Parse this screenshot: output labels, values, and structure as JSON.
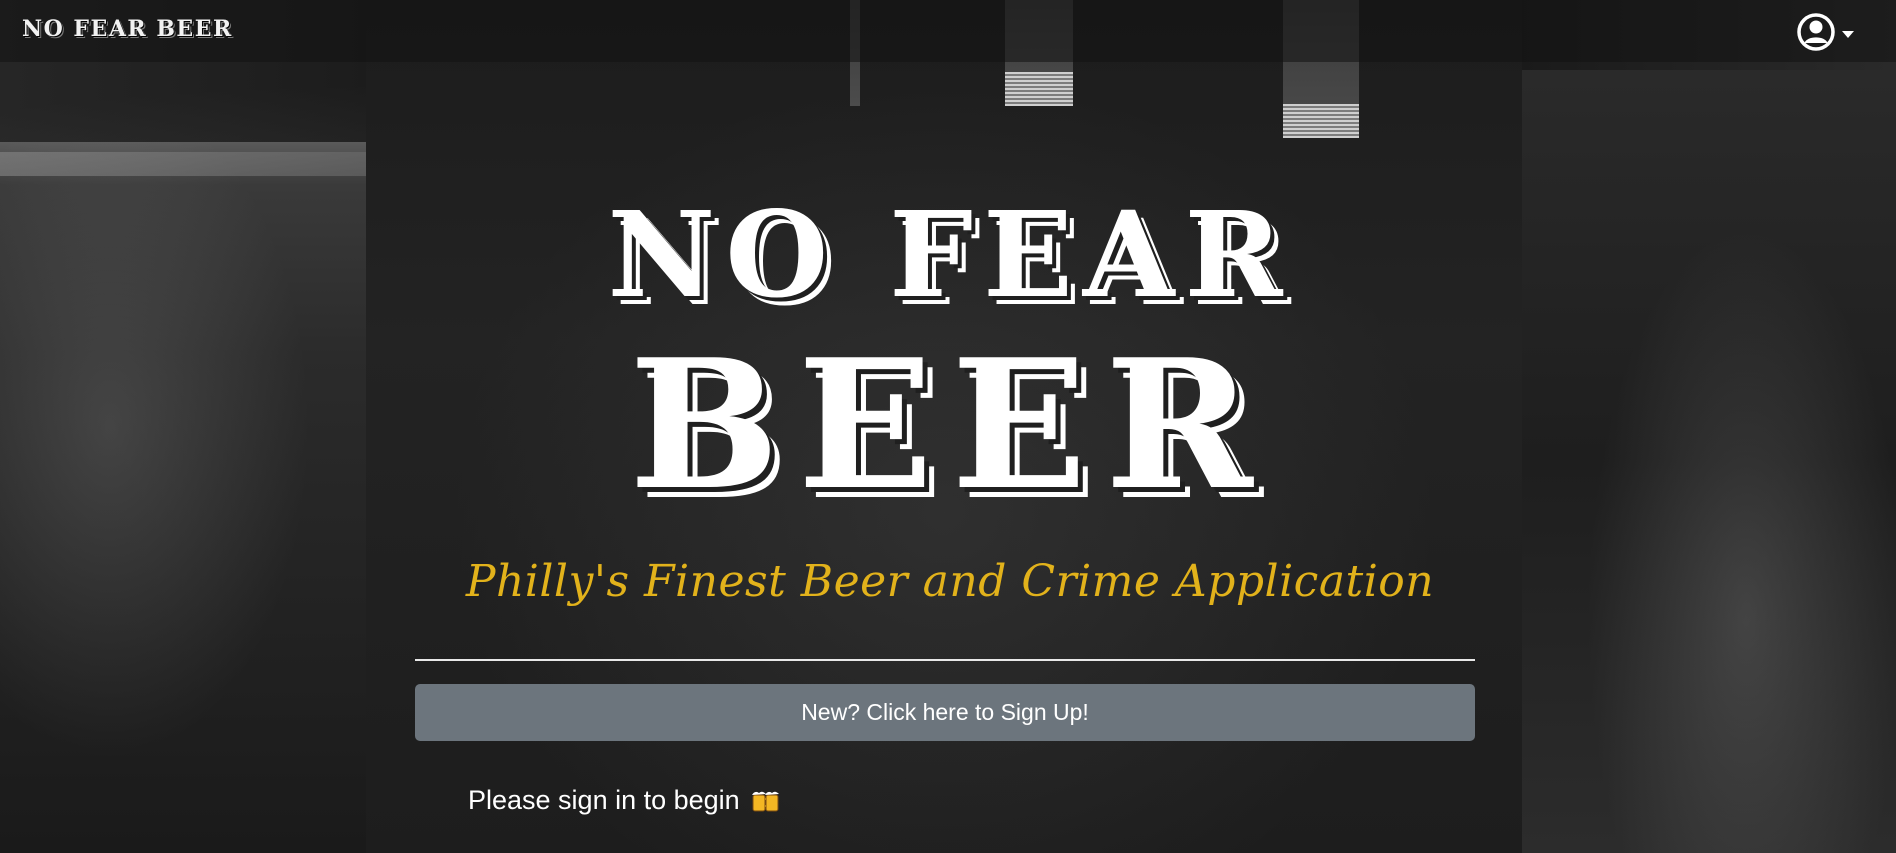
{
  "navbar": {
    "brand": "NO FEAR BEER",
    "user_icon": "user-circle-icon",
    "dropdown_icon": "caret-down-icon"
  },
  "hero": {
    "logo_line1": "NO FEAR",
    "logo_line2": "BEER",
    "tagline": "Philly's Finest Beer and Crime Application",
    "signup_label": "New? Click here to Sign Up!",
    "signin_message": "Please sign in to begin",
    "signin_icon": "beer-mugs-icon"
  },
  "colors": {
    "tagline": "#e2b21b",
    "button": "#6c757d",
    "text": "#ffffff"
  }
}
